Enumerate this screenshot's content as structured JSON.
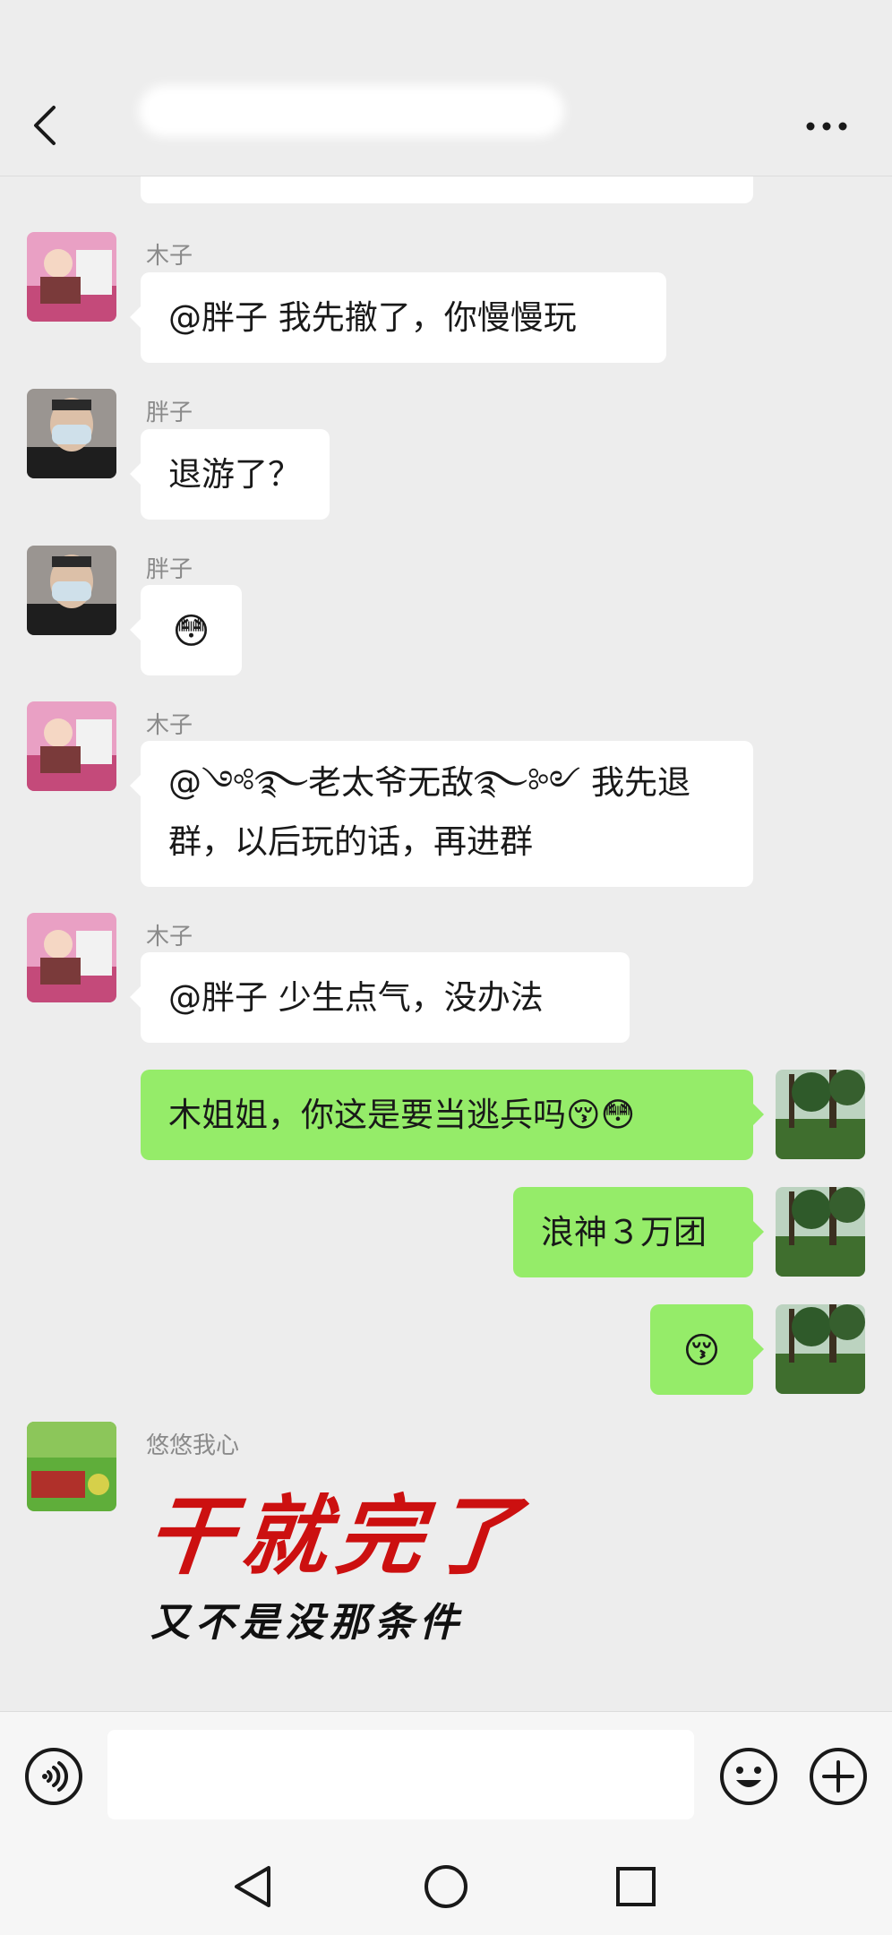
{
  "header": {
    "title": "",
    "back_icon": "chevron-left-icon",
    "more_icon": "more-dots-icon"
  },
  "messages": [
    {
      "side": "left",
      "sender": "木子",
      "text": "@胖子  我先撤了，你慢慢玩",
      "avatar": "child-on-ride-avatar"
    },
    {
      "side": "left",
      "sender": "胖子",
      "text": "退游了？",
      "avatar": "masked-man-avatar"
    },
    {
      "side": "left",
      "sender": "胖子",
      "text": "😳",
      "avatar": "masked-man-avatar"
    },
    {
      "side": "left",
      "sender": "木子",
      "line1": "@༺࿐老太爷无敌࿐༻ 我先退",
      "line2": "群，以后玩的话，再进群",
      "avatar": "child-on-ride-avatar"
    },
    {
      "side": "left",
      "sender": "木子",
      "text": "@胖子  少生点气，没办法",
      "avatar": "child-on-ride-avatar"
    },
    {
      "side": "right",
      "text": "木姐姐，你这是要当逃兵吗😚😳",
      "avatar": "trees-avatar"
    },
    {
      "side": "right",
      "text": "浪神３万团",
      "avatar": "trees-avatar"
    },
    {
      "side": "right",
      "text": "😚",
      "avatar": "trees-avatar"
    },
    {
      "side": "left",
      "sender": "悠悠我心",
      "avatar": "green-field-avatar"
    }
  ],
  "sticker": {
    "big_text": "干就完了",
    "small_text": "又不是没那条件"
  },
  "input": {
    "placeholder": "",
    "voice_icon": "voice-icon",
    "emoji_icon": "emoji-icon",
    "plus_icon": "plus-icon"
  },
  "nav": {
    "back": "nav-back-icon",
    "home": "nav-home-icon",
    "recents": "nav-recents-icon"
  },
  "colors": {
    "background": "#ededed",
    "bubble_left": "#ffffff",
    "bubble_right": "#95ec69",
    "sticker_red": "#cc1010"
  }
}
